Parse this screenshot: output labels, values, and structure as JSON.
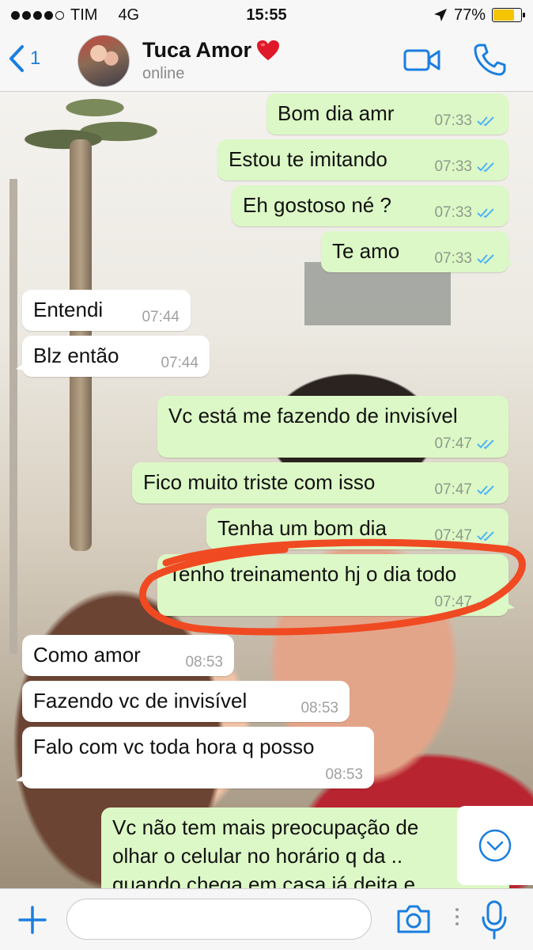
{
  "status_bar": {
    "carrier": "TIM",
    "network": "4G",
    "time": "15:55",
    "battery_percent": "77%",
    "battery_level": 0.77
  },
  "header": {
    "back_count": "1",
    "contact_name": "Tuca Amor",
    "contact_status": "online",
    "accent_color": "#1a7ee0"
  },
  "messages": [
    {
      "dir": "out",
      "text": "Bom dia amr",
      "time": "07:33"
    },
    {
      "dir": "out",
      "text": "Estou te imitando",
      "time": "07:33"
    },
    {
      "dir": "out",
      "text": "Eh gostoso né ?",
      "time": "07:33"
    },
    {
      "dir": "out",
      "text": "Te amo",
      "time": "07:33"
    },
    {
      "dir": "in",
      "text": "Entendi",
      "time": "07:44"
    },
    {
      "dir": "in",
      "text": "Blz então",
      "time": "07:44"
    },
    {
      "dir": "out",
      "text": "Vc está me fazendo de invisível",
      "time": "07:47"
    },
    {
      "dir": "out",
      "text": "Fico muito triste com isso",
      "time": "07:47"
    },
    {
      "dir": "out",
      "text": "Tenha um bom dia",
      "time": "07:47"
    },
    {
      "dir": "out",
      "text": "Tenho treinamento hj o dia todo",
      "time": "07:47"
    },
    {
      "dir": "in",
      "text": "Como amor",
      "time": "08:53"
    },
    {
      "dir": "in",
      "text": "Fazendo vc de invisível",
      "time": "08:53"
    },
    {
      "dir": "in",
      "text": "Falo com vc toda hora q posso",
      "time": "08:53"
    },
    {
      "dir": "out",
      "lines": [
        "Vc não tem mais preocupação de",
        "olhar o celular no horário q da ..",
        "quando chega em casa já deita e"
      ]
    }
  ],
  "colors": {
    "outgoing_bubble": "#dcf8c6",
    "incoming_bubble": "#ffffff",
    "annotation": "#f04a22",
    "read_ticks": "#4fb3f5"
  },
  "input": {
    "placeholder": "",
    "value": ""
  },
  "icons": [
    "back-chevron-icon",
    "heart-icon",
    "video-camera-icon",
    "phone-icon",
    "double-check-icon",
    "chevron-down-icon",
    "plus-icon",
    "camera-icon",
    "microphone-icon"
  ]
}
